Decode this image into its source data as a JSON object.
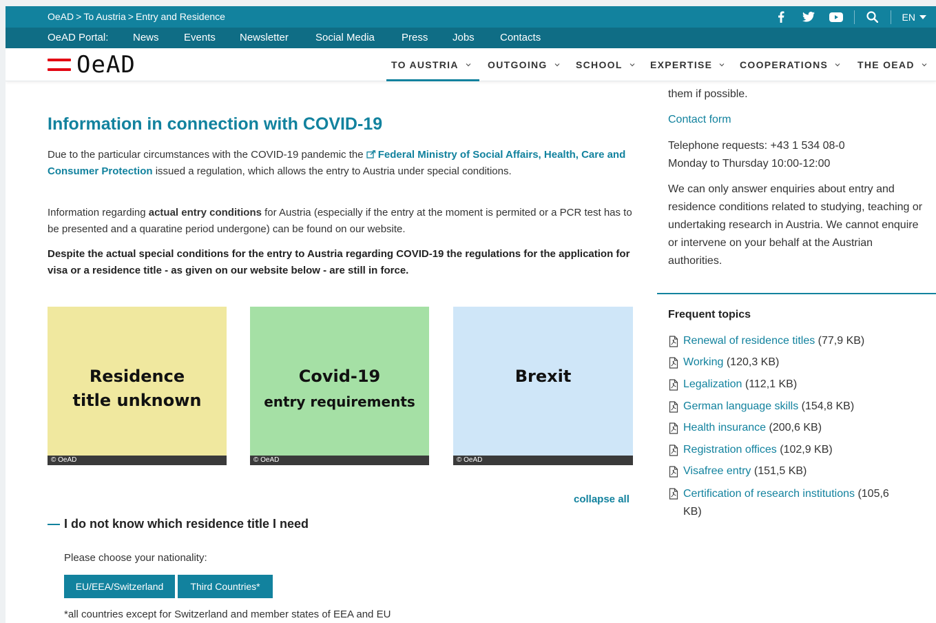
{
  "breadcrumb": [
    "OeAD",
    "To Austria",
    "Entry and Residence"
  ],
  "breadcrumb_separator": ">",
  "top_icons": [
    "facebook-icon",
    "twitter-icon",
    "youtube-icon",
    "search-icon"
  ],
  "language": "EN",
  "portal": {
    "label": "OeAD Portal:",
    "links": [
      "News",
      "Events",
      "Newsletter",
      "Social Media",
      "Press",
      "Jobs",
      "Contacts"
    ]
  },
  "logo_text": "OeAD",
  "nav": [
    "TO AUSTRIA",
    "OUTGOING",
    "SCHOOL",
    "EXPERTISE",
    "COOPERATIONS",
    "THE OEAD"
  ],
  "main": {
    "heading": "Information in connection with COVID-19",
    "p1_before": "Due to the particular circumstances with the COVID-19 pandemic the ",
    "p1_link": "Federal Ministry of Social Affairs, Health, Care and Consumer Protection",
    "p1_after": " issued a regulation, which allows the entry to Austria under special conditions.",
    "p2_before": "Information regarding ",
    "p2_bold": "actual entry conditions",
    "p2_after": " for Austria (especially if the entry at the moment is permited or a PCR test has to be presented and a quaratine period undergone) can be found on our website.",
    "p3": "Despite the actual special conditions for the entry to Austria regarding COVID-19 the regulations for the application for visa or a residence title - as given on our website below - are still in force.",
    "tiles": [
      {
        "line1": "Residence",
        "line2": "title unknown",
        "caption": "© OeAD",
        "color": "#f0e89f"
      },
      {
        "line1": "Covid-19",
        "line2": "entry requirements",
        "caption": "© OeAD",
        "color": "#a5e0a5"
      },
      {
        "line1": "Brexit",
        "line2": "",
        "caption": "© OeAD",
        "color": "#cfe6f8"
      }
    ],
    "collapse_all": "collapse all",
    "accordion_title": "I do not know which residence title I need",
    "choose_label": "Please choose your nationality:",
    "buttons": [
      "EU/EEA/Switzerland",
      "Third Countries*"
    ],
    "footnote": "*all countries except for Switzerland and member states of EEA and EU"
  },
  "sidebar": {
    "cut_text": "them if possible.",
    "contact_form": "Contact form",
    "phone_line1": "Telephone requests: +43 1 534 08-0",
    "phone_line2": "Monday to Thursday 10:00-12:00",
    "enquiries": "We can only answer enquiries about entry and residence conditions related to studying, teaching or undertaking research in Austria. We cannot enquire or intervene on your behalf at the Austrian authorities.",
    "frequent_title": "Frequent topics",
    "topics": [
      {
        "label": "Renewal of residence titles",
        "size": "(77,9 KB)"
      },
      {
        "label": "Working",
        "size": "(120,3 KB)"
      },
      {
        "label": "Legalization",
        "size": "(112,1 KB)"
      },
      {
        "label": "German language skills",
        "size": "(154,8 KB)"
      },
      {
        "label": "Health insurance",
        "size": "(200,6 KB)"
      },
      {
        "label": "Registration offices",
        "size": "(102,9 KB)"
      },
      {
        "label": "Visafree entry",
        "size": "(151,5 KB)"
      },
      {
        "label": "Certification of research institutions",
        "size": "(105,6 KB)"
      }
    ]
  },
  "colors": {
    "accent": "#12829e",
    "portal_bar": "#0f6d85",
    "flag_red": "#e30613"
  }
}
